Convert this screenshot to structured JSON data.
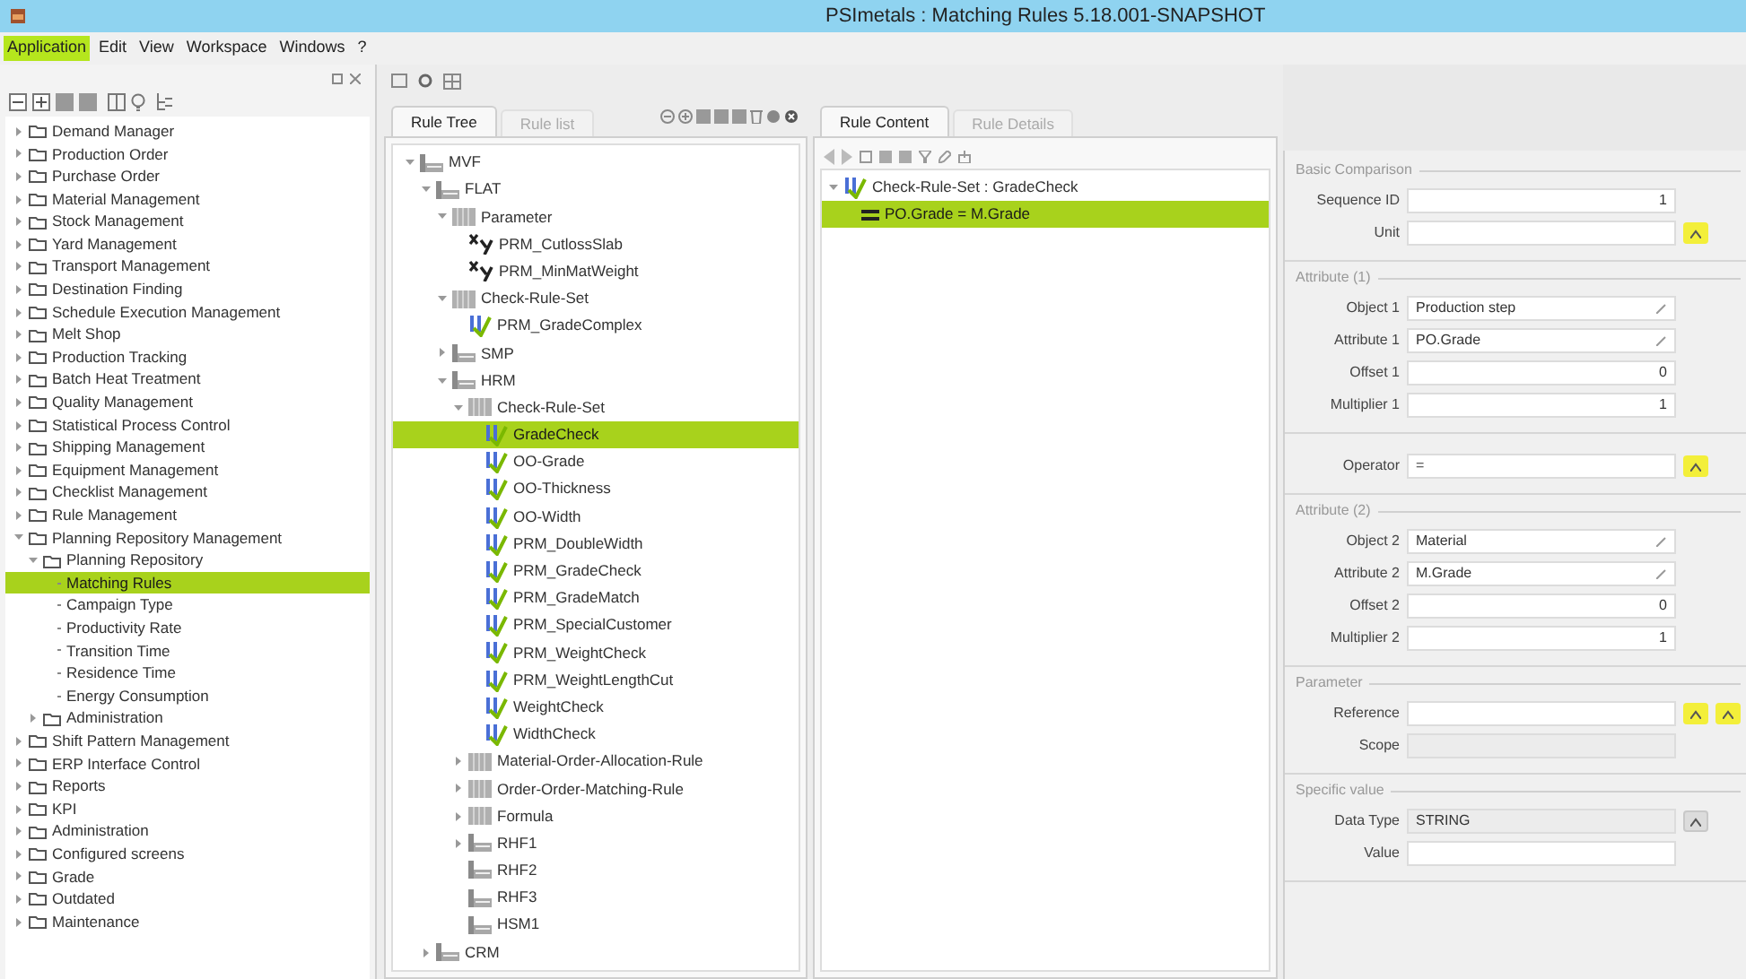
{
  "window": {
    "title": "PSImetals : Matching Rules 5.18.001-SNAPSHOT"
  },
  "menu": [
    {
      "label": "Application",
      "selected": true
    },
    {
      "label": "Edit",
      "selected": false
    },
    {
      "label": "View",
      "selected": false
    },
    {
      "label": "Workspace",
      "selected": false
    },
    {
      "label": "Windows",
      "selected": false
    },
    {
      "label": "?",
      "selected": false
    }
  ],
  "navigator": {
    "tree": [
      {
        "label": "Demand Manager",
        "kind": "folder",
        "expanded": false,
        "selected": false
      },
      {
        "label": "Production Order",
        "kind": "folder",
        "expanded": false,
        "selected": false
      },
      {
        "label": "Purchase Order",
        "kind": "folder",
        "expanded": false,
        "selected": false
      },
      {
        "label": "Material Management",
        "kind": "folder",
        "expanded": false,
        "selected": false
      },
      {
        "label": "Stock Management",
        "kind": "folder",
        "expanded": false,
        "selected": false
      },
      {
        "label": "Yard Management",
        "kind": "folder",
        "expanded": false,
        "selected": false
      },
      {
        "label": "Transport Management",
        "kind": "folder",
        "expanded": false,
        "selected": false
      },
      {
        "label": "Destination Finding",
        "kind": "folder",
        "expanded": false,
        "selected": false
      },
      {
        "label": "Schedule Execution Management",
        "kind": "folder",
        "expanded": false,
        "selected": false
      },
      {
        "label": "Melt Shop",
        "kind": "folder",
        "expanded": false,
        "selected": false
      },
      {
        "label": "Production Tracking",
        "kind": "folder",
        "expanded": false,
        "selected": false
      },
      {
        "label": "Batch Heat Treatment",
        "kind": "folder",
        "expanded": false,
        "selected": false
      },
      {
        "label": "Quality Management",
        "kind": "folder",
        "expanded": false,
        "selected": false
      },
      {
        "label": "Statistical Process Control",
        "kind": "folder",
        "expanded": false,
        "selected": false
      },
      {
        "label": "Shipping Management",
        "kind": "folder",
        "expanded": false,
        "selected": false
      },
      {
        "label": "Equipment Management",
        "kind": "folder",
        "expanded": false,
        "selected": false
      },
      {
        "label": "Checklist Management",
        "kind": "folder",
        "expanded": false,
        "selected": false
      },
      {
        "label": "Rule Management",
        "kind": "folder",
        "expanded": false,
        "selected": false
      },
      {
        "label": "Planning Repository Management",
        "kind": "folder",
        "expanded": true,
        "selected": false,
        "children": [
          {
            "label": "Planning Repository",
            "kind": "folder",
            "expanded": true,
            "selected": false,
            "children": [
              {
                "label": "Matching Rules",
                "kind": "leaf",
                "selected": true
              },
              {
                "label": "Campaign Type",
                "kind": "leaf",
                "selected": false
              },
              {
                "label": "Productivity Rate",
                "kind": "leaf",
                "selected": false
              },
              {
                "label": "Transition Time",
                "kind": "leaf",
                "selected": false
              },
              {
                "label": "Residence Time",
                "kind": "leaf",
                "selected": false
              },
              {
                "label": "Energy Consumption",
                "kind": "leaf",
                "selected": false
              }
            ]
          },
          {
            "label": "Administration",
            "kind": "folder",
            "expanded": false,
            "selected": false
          }
        ]
      },
      {
        "label": "Shift Pattern Management",
        "kind": "folder",
        "expanded": false,
        "selected": false
      },
      {
        "label": "ERP Interface Control",
        "kind": "folder",
        "expanded": false,
        "selected": false
      },
      {
        "label": "Reports",
        "kind": "folder",
        "expanded": false,
        "selected": false
      },
      {
        "label": "KPI",
        "kind": "folder",
        "expanded": false,
        "selected": false
      },
      {
        "label": "Administration",
        "kind": "folder",
        "expanded": false,
        "selected": false
      },
      {
        "label": "Configured screens",
        "kind": "folder",
        "expanded": false,
        "selected": false
      },
      {
        "label": "Grade",
        "kind": "folder",
        "expanded": false,
        "selected": false
      },
      {
        "label": "Outdated",
        "kind": "folder",
        "expanded": false,
        "selected": false
      },
      {
        "label": "Maintenance",
        "kind": "folder",
        "expanded": false,
        "selected": false
      }
    ]
  },
  "rule_tree_panel": {
    "tabs": [
      {
        "label": "Rule Tree",
        "selected": true
      },
      {
        "label": "Rule list",
        "selected": false
      }
    ],
    "tree": [
      {
        "label": "MVF",
        "kind": "plant",
        "expanded": true,
        "selected": false,
        "children": [
          {
            "label": "FLAT",
            "kind": "plant",
            "expanded": true,
            "selected": false,
            "children": [
              {
                "label": "Parameter",
                "kind": "folder",
                "expanded": true,
                "selected": false,
                "children": [
                  {
                    "label": "PRM_CutlossSlab",
                    "kind": "parameter",
                    "selected": false
                  },
                  {
                    "label": "PRM_MinMatWeight",
                    "kind": "parameter",
                    "selected": false
                  }
                ]
              },
              {
                "label": "Check-Rule-Set",
                "kind": "folder",
                "expanded": true,
                "selected": false,
                "children": [
                  {
                    "label": "PRM_GradeComplex",
                    "kind": "rule",
                    "selected": false
                  }
                ]
              },
              {
                "label": "SMP",
                "kind": "plant",
                "expanded": false,
                "selected": false
              },
              {
                "label": "HRM",
                "kind": "plant",
                "expanded": true,
                "selected": false,
                "children": [
                  {
                    "label": "Check-Rule-Set",
                    "kind": "folder",
                    "expanded": true,
                    "selected": false,
                    "children": [
                      {
                        "label": "GradeCheck",
                        "kind": "rule",
                        "selected": true
                      },
                      {
                        "label": "OO-Grade",
                        "kind": "rule",
                        "selected": false
                      },
                      {
                        "label": "OO-Thickness",
                        "kind": "rule",
                        "selected": false
                      },
                      {
                        "label": "OO-Width",
                        "kind": "rule",
                        "selected": false
                      },
                      {
                        "label": "PRM_DoubleWidth",
                        "kind": "rule",
                        "selected": false
                      },
                      {
                        "label": "PRM_GradeCheck",
                        "kind": "rule",
                        "selected": false
                      },
                      {
                        "label": "PRM_GradeMatch",
                        "kind": "rule",
                        "selected": false
                      },
                      {
                        "label": "PRM_SpecialCustomer",
                        "kind": "rule",
                        "selected": false
                      },
                      {
                        "label": "PRM_WeightCheck",
                        "kind": "rule",
                        "selected": false
                      },
                      {
                        "label": "PRM_WeightLengthCut",
                        "kind": "rule",
                        "selected": false
                      },
                      {
                        "label": "WeightCheck",
                        "kind": "rule",
                        "selected": false
                      },
                      {
                        "label": "WidthCheck",
                        "kind": "rule",
                        "selected": false
                      }
                    ]
                  },
                  {
                    "label": "Material-Order-Allocation-Rule",
                    "kind": "folder",
                    "expanded": false,
                    "selected": false
                  },
                  {
                    "label": "Order-Order-Matching-Rule",
                    "kind": "folder",
                    "expanded": false,
                    "selected": false
                  },
                  {
                    "label": "Formula",
                    "kind": "folder",
                    "expanded": false,
                    "selected": false
                  },
                  {
                    "label": "RHF1",
                    "kind": "plant",
                    "expanded": false,
                    "selected": false
                  },
                  {
                    "label": "RHF2",
                    "kind": "plant",
                    "selected": false
                  },
                  {
                    "label": "RHF3",
                    "kind": "plant",
                    "selected": false
                  },
                  {
                    "label": "HSM1",
                    "kind": "plant",
                    "selected": false
                  }
                ]
              }
            ]
          },
          {
            "label": "CRM",
            "kind": "plant",
            "expanded": false,
            "selected": false
          }
        ]
      }
    ]
  },
  "rule_content_panel": {
    "tabs": [
      {
        "label": "Rule Content",
        "selected": true
      },
      {
        "label": "Rule Details",
        "selected": false
      }
    ],
    "tree": [
      {
        "label": "Check-Rule-Set : GradeCheck",
        "kind": "rule",
        "expanded": true,
        "selected": false,
        "children": [
          {
            "label": "PO.Grade = M.Grade",
            "kind": "comparison",
            "selected": true
          }
        ]
      }
    ]
  },
  "details": {
    "sections": [
      {
        "title": "Basic Comparison",
        "fields": [
          {
            "label": "Sequence ID",
            "kind": "number",
            "value": "1"
          },
          {
            "label": "Unit",
            "kind": "select"
          }
        ]
      },
      {
        "title": "Attribute (1)",
        "fields": [
          {
            "label": "Object 1",
            "kind": "edit",
            "value": "Production step"
          },
          {
            "label": "Attribute 1",
            "kind": "edit",
            "value": "PO.Grade"
          },
          {
            "label": "Offset 1",
            "kind": "number",
            "value": "0"
          },
          {
            "label": "Multiplier 1",
            "kind": "number",
            "value": "1"
          }
        ]
      },
      {
        "fields": [
          {
            "label": "Operator",
            "kind": "select",
            "value": "="
          }
        ]
      },
      {
        "title": "Attribute (2)",
        "fields": [
          {
            "label": "Object 2",
            "kind": "edit",
            "value": "Material"
          },
          {
            "label": "Attribute 2",
            "kind": "edit",
            "value": "M.Grade"
          },
          {
            "label": "Offset 2",
            "kind": "number",
            "value": "0"
          },
          {
            "label": "Multiplier 2",
            "kind": "number",
            "value": "1"
          }
        ]
      },
      {
        "title": "Parameter",
        "fields": [
          {
            "label": "Reference",
            "kind": "reference"
          },
          {
            "label": "Scope",
            "kind": "readonly"
          }
        ]
      },
      {
        "title": "Specific value",
        "fields": [
          {
            "label": "Data Type",
            "kind": "readonly-select",
            "value": "STRING"
          },
          {
            "label": "Value",
            "kind": "text"
          }
        ]
      }
    ]
  }
}
